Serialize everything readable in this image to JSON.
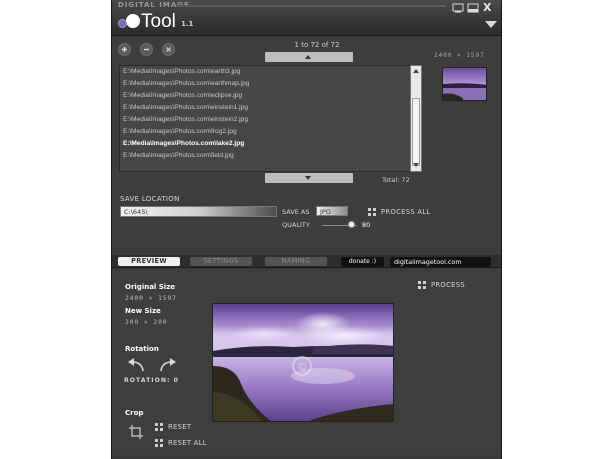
{
  "titlebar": {
    "brand": "DIGITAL IMAGE",
    "title": "Tool",
    "version": "1.1",
    "controls": [
      "minimize-icon",
      "restore-icon",
      "maximize-icon",
      "close-icon"
    ],
    "close_label": "X"
  },
  "files": {
    "counter": "1 to 72 of 72",
    "dims": "2400 × 1597",
    "list": [
      "E:\\Media\\Images\\Photos.com\\earth3.jpg",
      "E:\\Media\\Images\\Photos.com\\earthmap.jpg",
      "E:\\Media\\Images\\Photos.com\\eclipse.jpg",
      "E:\\Media\\Images\\Photos.com\\einstein1.jpg",
      "E:\\Media\\Images\\Photos.com\\einstein2.jpg",
      "E:\\Media\\Images\\Photos.com\\frog2.jpg",
      "E:\\Media\\Images\\Photos.com\\lake2.jpg",
      "E:\\Media\\Images\\Photos.com\\field.jpg"
    ],
    "selected_index": 6,
    "total": "Total: 72",
    "list_buttons": [
      "add-icon",
      "remove-icon",
      "clear-icon"
    ]
  },
  "save": {
    "label": "SAVE LOCATION",
    "path": "C:\\645\\",
    "save_as_label": "SAVE AS",
    "format": "JPG",
    "process_all": "PROCESS ALL",
    "quality_label": "QUALITY",
    "quality": 80,
    "quality_display": "80"
  },
  "tabs": {
    "preview": "PREVIEW",
    "settings": "SETTINGS",
    "naming": "NAMING",
    "donate": "donate :)",
    "site": "digitalimagetool.com"
  },
  "preview": {
    "original_label": "Original Size",
    "original_value": "2400 × 1597",
    "new_label": "New Size",
    "new_value": "300 × 200",
    "rotation_label": "Rotation",
    "rotation_value": "ROTATION: 0",
    "crop_label": "Crop",
    "reset": "RESET",
    "reset_all": "RESET ALL",
    "process": "PROCESS",
    "watermark": "©"
  },
  "colors": {
    "window_bg": "#3a3a3a",
    "sky_purple": "#9b7fc6",
    "accent": "#7b6bb3"
  }
}
